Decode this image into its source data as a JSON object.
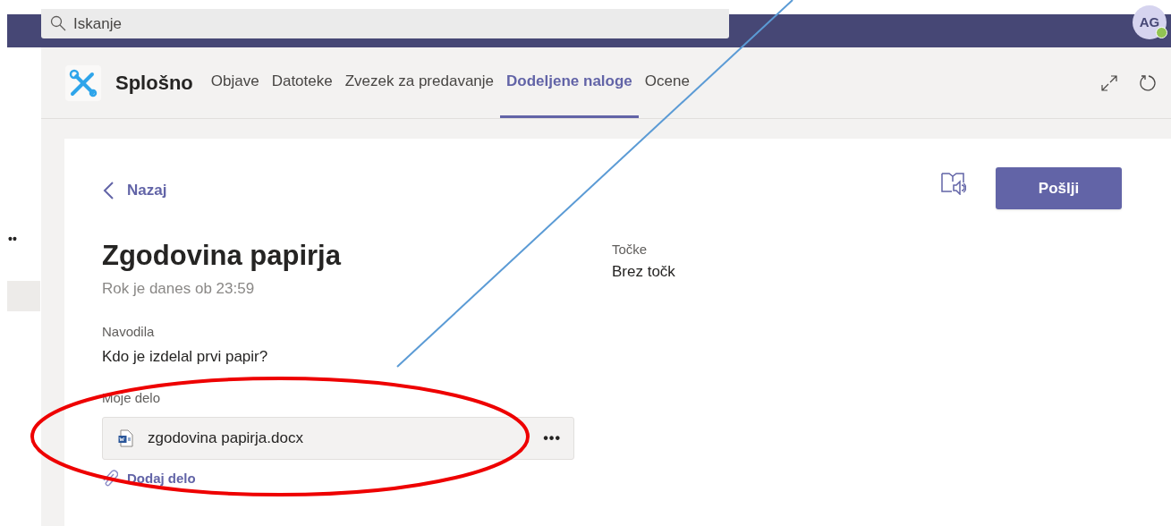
{
  "search": {
    "placeholder": "Iskanje"
  },
  "avatar": {
    "initials": "AG",
    "online": true
  },
  "rail": {
    "more": "••",
    "items": [
      {
        "selected": true
      }
    ]
  },
  "channel": {
    "name": "Splošno"
  },
  "tabs": [
    {
      "label": "Objave",
      "selected": false
    },
    {
      "label": "Datoteke",
      "selected": false
    },
    {
      "label": "Zvezek za predavanje",
      "selected": false
    },
    {
      "label": "Dodeljene naloge",
      "selected": true
    },
    {
      "label": "Ocene",
      "selected": false
    }
  ],
  "assignment": {
    "back": "Nazaj",
    "submit": "Pošlji",
    "title": "Zgodovina papirja",
    "due": "Rok je danes ob 23:59",
    "instructions_label": "Navodila",
    "instructions": "Kdo je izdelal prvi papir?",
    "points_label": "Točke",
    "points": "Brez točk",
    "work_label": "Moje delo",
    "files": [
      {
        "name": "zgodovina papirja.docx",
        "more": "•••"
      }
    ],
    "add_work": "Dodaj delo"
  }
}
